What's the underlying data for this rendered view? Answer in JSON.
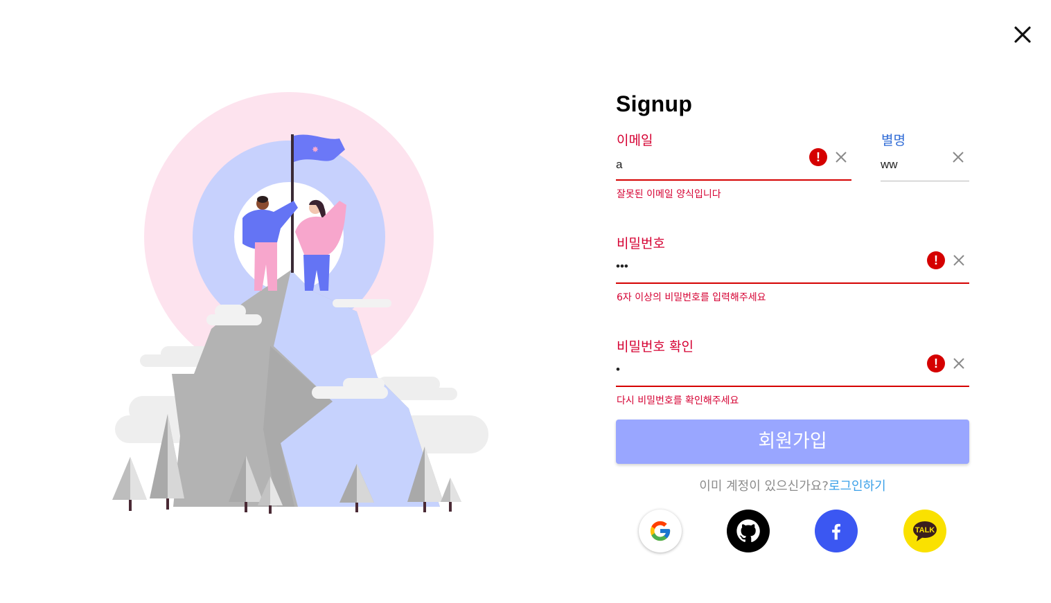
{
  "title": "Signup",
  "icons": {
    "close": "close-icon",
    "error": "error-icon",
    "clear": "clear-icon"
  },
  "fields": {
    "email": {
      "label": "이메일",
      "value": "a",
      "error": "잘못된 이메일 양식입니다",
      "error_icon_text": "!"
    },
    "nickname": {
      "label": "별명",
      "value": "ww"
    },
    "password": {
      "label": "비밀번호",
      "value": "•••",
      "error": "6자 이상의 비밀번호를 입력해주세요",
      "error_icon_text": "!"
    },
    "password_confirm": {
      "label": "비밀번호 확인",
      "value": "•",
      "error": "다시 비밀번호를 확인해주세요",
      "error_icon_text": "!"
    }
  },
  "submit_label": "회원가입",
  "login_prompt": {
    "text": "이미 계정이 있으신가요?",
    "link": "로그인하기"
  },
  "social": {
    "kakao_label": "TALK"
  },
  "colors": {
    "error": "#d50000",
    "label_error": "#d50032",
    "label_ok": "#2f6bd6",
    "submit_bg": "#99a6ff",
    "link": "#3aa0e8",
    "facebook": "#3b57f2",
    "kakao": "#fae100"
  }
}
